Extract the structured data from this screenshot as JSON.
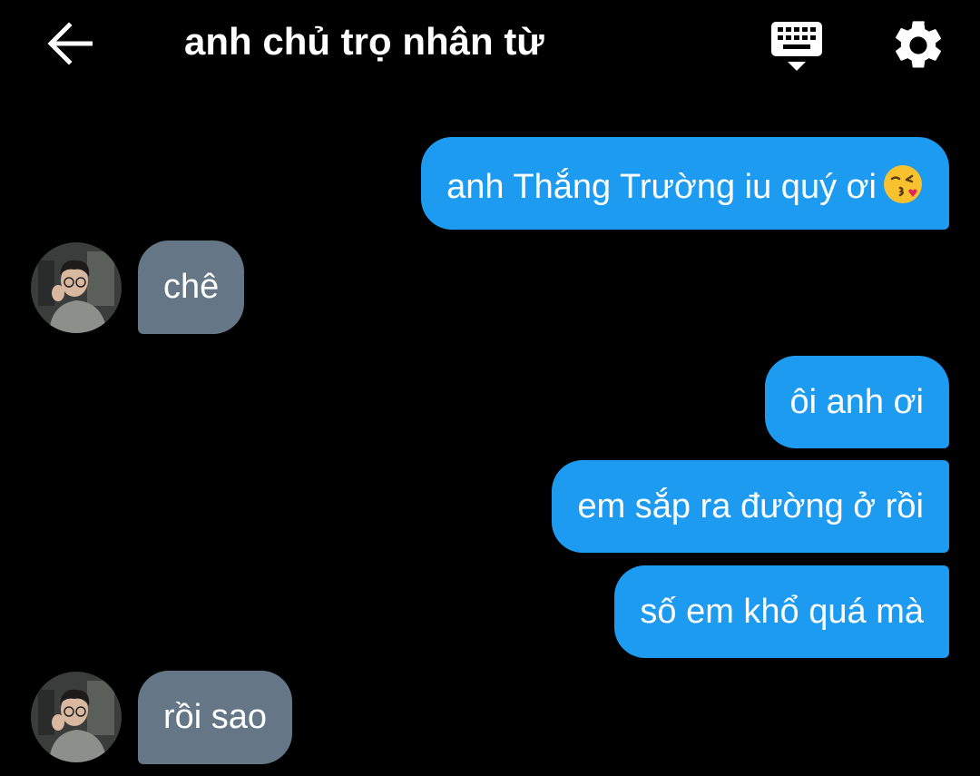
{
  "header": {
    "title": "anh chủ trọ nhân từ",
    "back_icon": "arrow-left-icon",
    "keyboard_icon": "keyboard-hide-icon",
    "settings_icon": "gear-icon"
  },
  "colors": {
    "background": "#000000",
    "outgoing_bubble": "#1d9bf0",
    "incoming_bubble": "#657786",
    "text": "#ffffff"
  },
  "messages": [
    {
      "direction": "out",
      "text": "anh Thắng Trường iu quý ơi",
      "emoji": "face-blowing-kiss-icon"
    },
    {
      "direction": "in",
      "text": "chê"
    },
    {
      "direction": "out",
      "text": "ôi anh ơi"
    },
    {
      "direction": "out",
      "text": "em sắp ra đường ở rồi"
    },
    {
      "direction": "out",
      "text": "số em khổ quá mà"
    },
    {
      "direction": "in",
      "text": "rồi sao"
    }
  ]
}
